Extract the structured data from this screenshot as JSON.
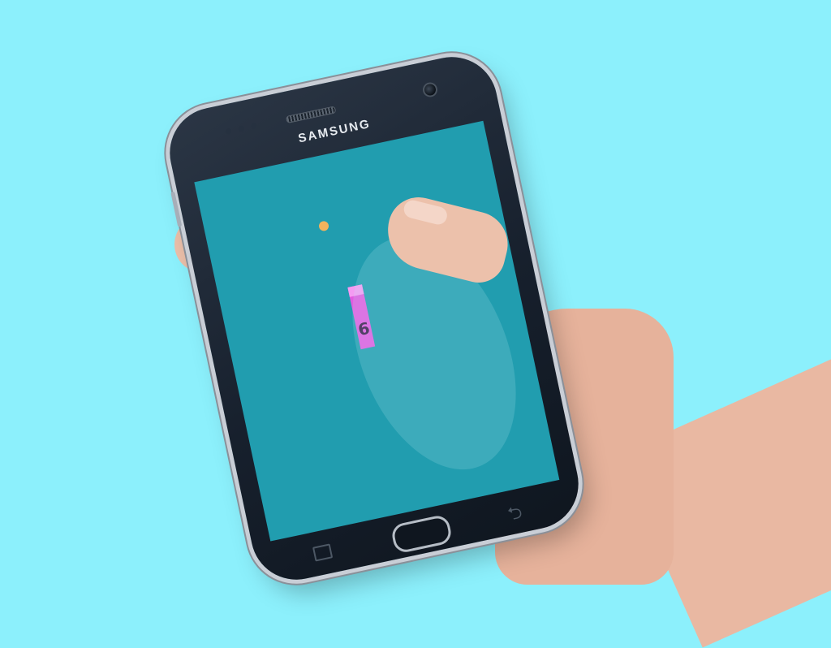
{
  "background_color": "#8cf0fc",
  "phone": {
    "brand": "SAMSUNG",
    "body_color": "#1b2430",
    "screen_color": "#219daf",
    "icons": {
      "home": "home-button",
      "recents": "recents-icon",
      "back": "back-icon"
    }
  },
  "game": {
    "ball_color": "#f2b35c",
    "paddle_color": "#e25be0",
    "paddle_highlight_color": "#f49bf2",
    "score": "6"
  },
  "hand": {
    "skin_color": "#e8b49e"
  }
}
